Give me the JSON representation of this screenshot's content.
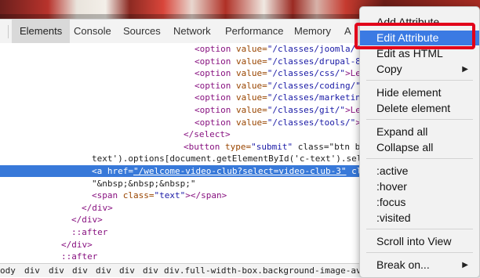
{
  "tabs": [
    "Elements",
    "Console",
    "Sources",
    "Network",
    "Performance",
    "Memory",
    "A"
  ],
  "code_lines": [
    {
      "indent": 248,
      "tag": "<option",
      "attr": " value=",
      "val": "\"/classes/joomla/\"",
      "tail": ""
    },
    {
      "indent": 248,
      "tag": "<option",
      "attr": " value=",
      "val": "\"/classes/drupal-8/\"",
      "tail": ""
    },
    {
      "indent": 248,
      "tag": "<option",
      "attr": " value=",
      "val": "\"/classes/css/\"",
      "tail": ">Le"
    },
    {
      "indent": 248,
      "tag": "<option",
      "attr": " value=",
      "val": "\"/classes/coding/\"",
      "tail": ""
    },
    {
      "indent": 248,
      "tag": "<option",
      "attr": " value=",
      "val": "\"/classes/marketing/\"",
      "tail": ""
    },
    {
      "indent": 248,
      "tag": "<option",
      "attr": " value=",
      "val": "\"/classes/git/\"",
      "tail": ">Le"
    },
    {
      "indent": 248,
      "tag": "<option",
      "attr": " value=",
      "val": "\"/classes/tools/\"",
      "tail": ">Le"
    },
    {
      "indent": 234,
      "tag": "</select>",
      "attr": "",
      "val": "",
      "tail": ""
    },
    {
      "indent": 234,
      "tag": "<button",
      "attr": " type=",
      "val": "\"submit\"",
      "tail": " class=\"btn btn"
    },
    {
      "indent": 117,
      "tag": "",
      "attr": "",
      "val": "",
      "tail": "text').options[document.getElementById('c-text').sel"
    },
    {
      "indent": 117,
      "tag": "<a",
      "attr": " href=",
      "val": "\"/welcome-video-club?select=video-club-3\"",
      "tail": " cl"
    },
    {
      "indent": 117,
      "tag": "",
      "attr": "",
      "val": "",
      "tail": "\"&nbsp;&nbsp;&nbsp;\""
    },
    {
      "indent": 117,
      "tag": "<span",
      "attr": " class=",
      "val": "\"text\"",
      "tail": "></span>"
    },
    {
      "indent": 104,
      "tag": "</div>",
      "attr": "",
      "val": "",
      "tail": ""
    },
    {
      "indent": 91,
      "tag": "</div>",
      "attr": "",
      "val": "",
      "tail": ""
    },
    {
      "indent": 91,
      "tag": "::after",
      "attr": "",
      "val": "",
      "tail": ""
    },
    {
      "indent": 78,
      "tag": "</div>",
      "attr": "",
      "val": "",
      "tail": ""
    },
    {
      "indent": 78,
      "tag": "::after",
      "attr": "",
      "val": "",
      "tail": ""
    },
    {
      "indent": 65,
      "tag": "</div>",
      "attr": "",
      "val": "",
      "tail": ""
    },
    {
      "indent": 52,
      "tag": "</div>",
      "attr": "",
      "val": "",
      "tail": ""
    }
  ],
  "selected_line": 10,
  "selected_right_fragment": "S",
  "breadcrumbs": [
    "ody",
    "div",
    "div",
    "div",
    "div",
    "div",
    "div",
    "div.full-width-box.background-image-available"
  ],
  "context_menu": {
    "items": [
      {
        "label": "Add Attribute",
        "group": 0
      },
      {
        "label": "Edit Attribute",
        "group": 0,
        "highlighted": true
      },
      {
        "label": "Edit as HTML",
        "group": 0
      },
      {
        "label": "Copy",
        "group": 0,
        "submenu": true
      },
      {
        "label": "Hide element",
        "group": 1
      },
      {
        "label": "Delete element",
        "group": 1
      },
      {
        "label": "Expand all",
        "group": 2
      },
      {
        "label": "Collapse all",
        "group": 2
      },
      {
        "label": ":active",
        "group": 3
      },
      {
        "label": ":hover",
        "group": 3
      },
      {
        "label": ":focus",
        "group": 3
      },
      {
        "label": ":visited",
        "group": 3
      },
      {
        "label": "Scroll into View",
        "group": 4
      },
      {
        "label": "Break on...",
        "group": 5,
        "submenu": true
      }
    ],
    "submenu_arrow": "▶",
    "highlight_color": "#3b7ae3",
    "callout_color": "#e2001a"
  }
}
